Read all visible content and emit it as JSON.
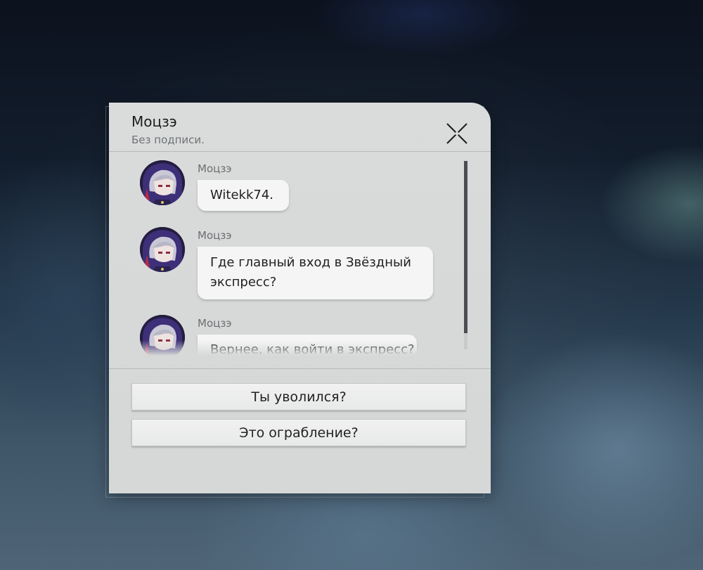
{
  "dialog": {
    "contact_name": "Моцзэ",
    "contact_signature": "Без подписи.",
    "close_icon": "close-x-icon"
  },
  "messages": [
    {
      "sender": "Моцзэ",
      "text": "Witekk74.",
      "avatar": "moze-avatar"
    },
    {
      "sender": "Моцзэ",
      "text": "Где главный вход в Звёздный экспресс?",
      "avatar": "moze-avatar"
    },
    {
      "sender": "Моцзэ",
      "text": "Вернее, как войти в экспресс?",
      "avatar": "moze-avatar"
    }
  ],
  "options": [
    {
      "label": "Ты уволился?"
    },
    {
      "label": "Это ограбление?"
    }
  ],
  "colors": {
    "panel": "#d8dada",
    "bubble": "#f5f5f5",
    "option": "#ededed",
    "text": "#1f1f1f"
  }
}
